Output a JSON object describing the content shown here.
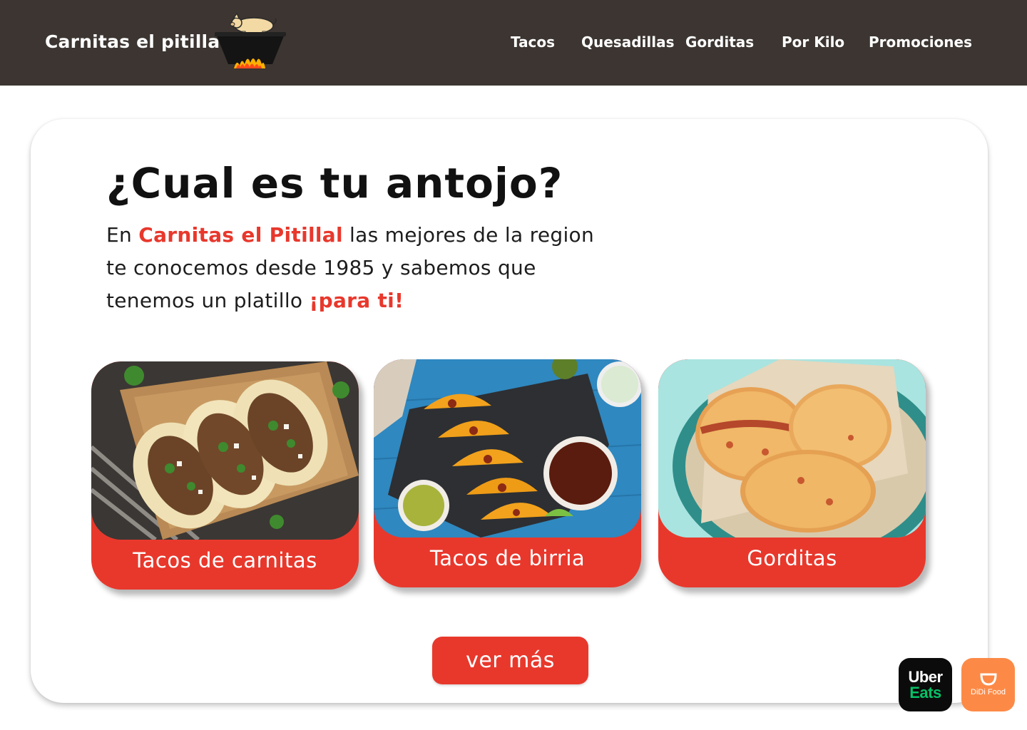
{
  "header": {
    "brand": "Carnitas el pitilla",
    "logo_icon": "pig-on-cauldron-icon",
    "nav": [
      "Tacos",
      "Quesadillas",
      "Gorditas",
      "Por Kilo",
      "Promociones"
    ],
    "background": "#3c3531"
  },
  "hero": {
    "headline": "¿Cual es tu antojo?",
    "intro_part1": "En ",
    "intro_highlight1": "Carnitas el Pitillal",
    "intro_part2": " las mejores de la region te conocemos desde 1985 y sabemos que tenemos un platillo ",
    "intro_highlight2": "¡para ti!"
  },
  "products": [
    {
      "label": "Tacos de carnitas",
      "image": "tacos-de-carnitas-photo"
    },
    {
      "label": "Tacos de birria",
      "image": "tacos-de-birria-photo"
    },
    {
      "label": "Gorditas",
      "image": "gorditas-photo"
    }
  ],
  "cta": {
    "label": "ver más"
  },
  "delivery": {
    "uber": {
      "line1": "Uber",
      "line2": "Eats"
    },
    "didi": {
      "text": "DiDi Food"
    }
  },
  "colors": {
    "accent": "#e8382c",
    "header_bg": "#3c3531",
    "uber_green": "#06c167",
    "didi_orange": "#fc8a46"
  }
}
